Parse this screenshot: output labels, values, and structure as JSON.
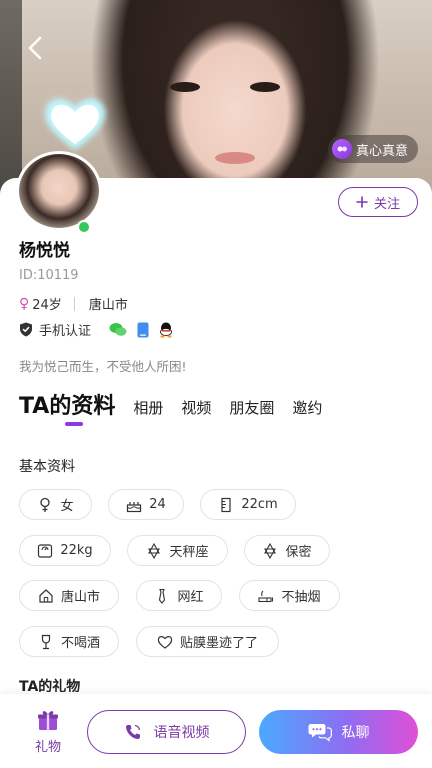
{
  "hero": {
    "sincere_badge": "真心真意"
  },
  "profile": {
    "follow_label": "关注",
    "name": "杨悦悦",
    "id_text": "ID:10119",
    "age": "24岁",
    "city": "唐山市",
    "verify_label": "手机认证",
    "bio": "我为悦己而生，不受他人所困!"
  },
  "tabs": {
    "active": "TA的资料",
    "items": [
      "相册",
      "视频",
      "朋友圈",
      "邀约"
    ]
  },
  "basic_info": {
    "title": "基本资料",
    "chips": [
      {
        "icon": "female-icon",
        "label": "女"
      },
      {
        "icon": "cake-icon",
        "label": "24"
      },
      {
        "icon": "height-icon",
        "label": "22cm"
      },
      {
        "icon": "scale-icon",
        "label": "22kg"
      },
      {
        "icon": "star-icon",
        "label": "天秤座"
      },
      {
        "icon": "star-icon",
        "label": "保密"
      },
      {
        "icon": "home-icon",
        "label": "唐山市"
      },
      {
        "icon": "tie-icon",
        "label": "网红"
      },
      {
        "icon": "cigarette-icon",
        "label": "不抽烟"
      },
      {
        "icon": "wine-glass-icon",
        "label": "不喝酒"
      },
      {
        "icon": "heart-icon",
        "label": "贴膜墨迹了了"
      }
    ]
  },
  "gifts_title": "TA的礼物",
  "bottom_bar": {
    "gift_label": "礼物",
    "voice_video_label": "语音视频",
    "chat_label": "私聊"
  },
  "colors": {
    "accent": "#7a3aa8",
    "online": "#34c759",
    "female": "#d04fb5"
  }
}
